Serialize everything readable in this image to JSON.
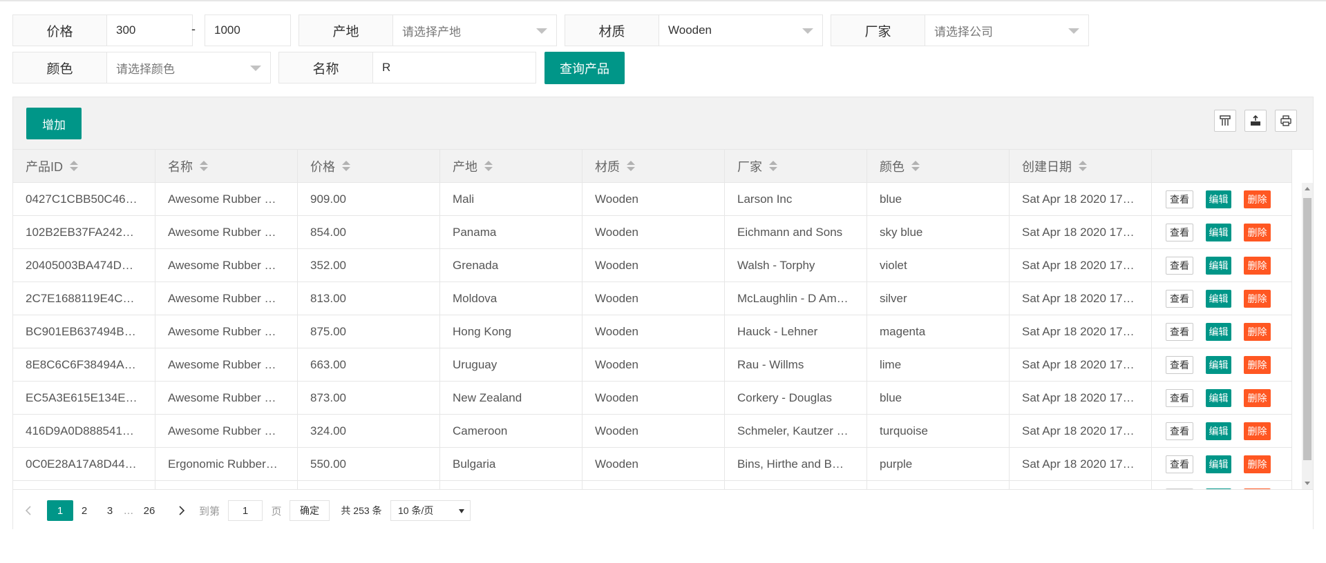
{
  "filters": {
    "price_label": "价格",
    "price_min": "300",
    "price_dash": "-",
    "price_max": "1000",
    "origin_label": "产地",
    "origin_placeholder": "请选择产地",
    "material_label": "材质",
    "material_value": "Wooden",
    "maker_label": "厂家",
    "maker_placeholder": "请选择公司",
    "color_label": "颜色",
    "color_placeholder": "请选择颜色",
    "name_label": "名称",
    "name_value": "R",
    "query_button": "查询产品"
  },
  "toolbar": {
    "add_button": "增加",
    "icons": [
      "columns-icon",
      "export-icon",
      "print-icon"
    ]
  },
  "table": {
    "columns": [
      "产品ID",
      "名称",
      "价格",
      "产地",
      "材质",
      "厂家",
      "颜色",
      "创建日期"
    ],
    "actions": {
      "view": "查看",
      "edit": "编辑",
      "delete": "删除"
    },
    "rows": [
      [
        "0427C1CBB50C46…",
        "Awesome Rubber …",
        "909.00",
        "Mali",
        "Wooden",
        "Larson Inc",
        "blue",
        "Sat Apr 18 2020 17…"
      ],
      [
        "102B2EB37FA242…",
        "Awesome Rubber …",
        "854.00",
        "Panama",
        "Wooden",
        "Eichmann and Sons",
        "sky blue",
        "Sat Apr 18 2020 17…"
      ],
      [
        "20405003BA474D…",
        "Awesome Rubber …",
        "352.00",
        "Grenada",
        "Wooden",
        "Walsh - Torphy",
        "violet",
        "Sat Apr 18 2020 17…"
      ],
      [
        "2C7E1688119E4C…",
        "Awesome Rubber …",
        "813.00",
        "Moldova",
        "Wooden",
        "McLaughlin - D Am…",
        "silver",
        "Sat Apr 18 2020 17…"
      ],
      [
        "BC901EB637494B…",
        "Awesome Rubber …",
        "875.00",
        "Hong Kong",
        "Wooden",
        "Hauck - Lehner",
        "magenta",
        "Sat Apr 18 2020 17…"
      ],
      [
        "8E8C6C6F38494A…",
        "Awesome Rubber …",
        "663.00",
        "Uruguay",
        "Wooden",
        "Rau - Willms",
        "lime",
        "Sat Apr 18 2020 17…"
      ],
      [
        "EC5A3E615E134E…",
        "Awesome Rubber …",
        "873.00",
        "New Zealand",
        "Wooden",
        "Corkery - Douglas",
        "blue",
        "Sat Apr 18 2020 17…"
      ],
      [
        "416D9A0D888541…",
        "Awesome Rubber …",
        "324.00",
        "Cameroon",
        "Wooden",
        "Schmeler, Kautzer …",
        "turquoise",
        "Sat Apr 18 2020 17…"
      ],
      [
        "0C0E28A17A8D44…",
        "Ergonomic Rubber…",
        "550.00",
        "Bulgaria",
        "Wooden",
        "Bins, Hirthe and B…",
        "purple",
        "Sat Apr 18 2020 17…"
      ]
    ]
  },
  "pagination": {
    "pages": [
      "1",
      "2",
      "3"
    ],
    "ellipsis": "…",
    "last_page": "26",
    "goto_label": "到第",
    "goto_value": "1",
    "page_unit": "页",
    "confirm_button": "确定",
    "total_text": "共 253 条",
    "page_size": "10 条/页"
  },
  "colors": {
    "primary": "#009688",
    "danger": "#ff5722",
    "border": "#e6e6e6"
  }
}
